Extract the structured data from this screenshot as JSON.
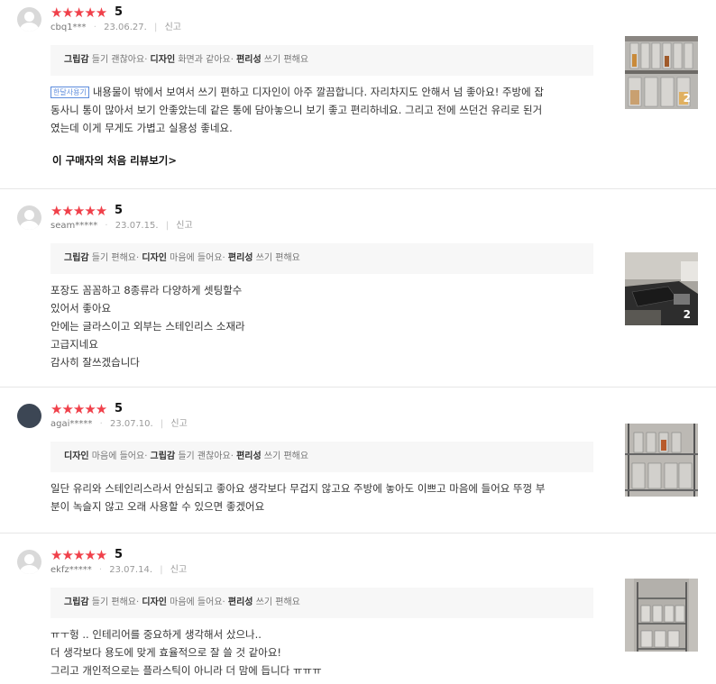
{
  "reviews": [
    {
      "rating_stars": "★★★★★",
      "score": "5",
      "user": "cbq1***",
      "date": "23.06.27.",
      "report": "신고",
      "attrs": [
        {
          "label": "그립감",
          "value": "들기 괜찮아요"
        },
        {
          "label": "디자인",
          "value": "화면과 같아요"
        },
        {
          "label": "편리성",
          "value": "쓰기 편해요"
        }
      ],
      "badge": "한달사용기",
      "lines": [
        "내용물이 밖에서 보여서 쓰기 편하고 디자인이 아주 깔끔합니다. 자리차지도 안해서 넘 좋아요! 주방에 잡",
        "동사니 통이 많아서 보기 안좋았는데 같은 통에 담아놓으니 보기 좋고 편리하네요. 그리고 전에 쓰던건 유리로 된거",
        "였는데 이게 무게도 가볍고 실용성 좋네요."
      ],
      "first_review_link": "이 구매자의 처음 리뷰보기",
      "photo_count": "2",
      "photo_icon": "photo-kitchen-canisters-shelf"
    },
    {
      "rating_stars": "★★★★★",
      "score": "5",
      "user": "seam*****",
      "date": "23.07.15.",
      "report": "신고",
      "attrs": [
        {
          "label": "그립감",
          "value": "들기 편해요"
        },
        {
          "label": "디자인",
          "value": "마음에 들어요"
        },
        {
          "label": "편리성",
          "value": "쓰기 편해요"
        }
      ],
      "lines": [
        "포장도 꼼꼼하고 8종류라 다양하게 셋팅할수",
        "있어서 좋아요",
        "안에는 글라스이고 외부는 스테인리스 소재라",
        "고급지네요",
        "감사히 잘쓰겠습니다"
      ],
      "photo_count": "2",
      "photo_icon": "photo-kitchen-counter"
    },
    {
      "rating_stars": "★★★★★",
      "score": "5",
      "user": "agai*****",
      "date": "23.07.10.",
      "report": "신고",
      "attrs": [
        {
          "label": "디자인",
          "value": "마음에 들어요"
        },
        {
          "label": "그립감",
          "value": "들기 괜찮아요"
        },
        {
          "label": "편리성",
          "value": "쓰기 편해요"
        }
      ],
      "lines": [
        "일단 유리와 스테인리스라서 안심되고 좋아요 생각보다 무겁지 않고요 주방에 놓아도 이쁘고 마음에 들어요 뚜껑 부",
        "분이 녹슬지 않고 오래 사용할 수 있으면 좋겠어요"
      ],
      "photo_icon": "photo-canisters-rack"
    },
    {
      "rating_stars": "★★★★★",
      "score": "5",
      "user": "ekfz*****",
      "date": "23.07.14.",
      "report": "신고",
      "attrs": [
        {
          "label": "그립감",
          "value": "들기 편해요"
        },
        {
          "label": "디자인",
          "value": "마음에 들어요"
        },
        {
          "label": "편리성",
          "value": "쓰기 편해요"
        }
      ],
      "lines": [
        "ㅠㅜ헝 .. 인테리어를 중요하게 생각해서 샀으나..",
        "더 생각보다 용도에 맞게 효율적으로 잘 쓸 것 같아요!",
        "그리고 개인적으로는 플라스틱이 아니라 더 맘에 듭니다 ㅠㅠㅠ"
      ],
      "photo_icon": "photo-canisters-wire-rack"
    }
  ]
}
